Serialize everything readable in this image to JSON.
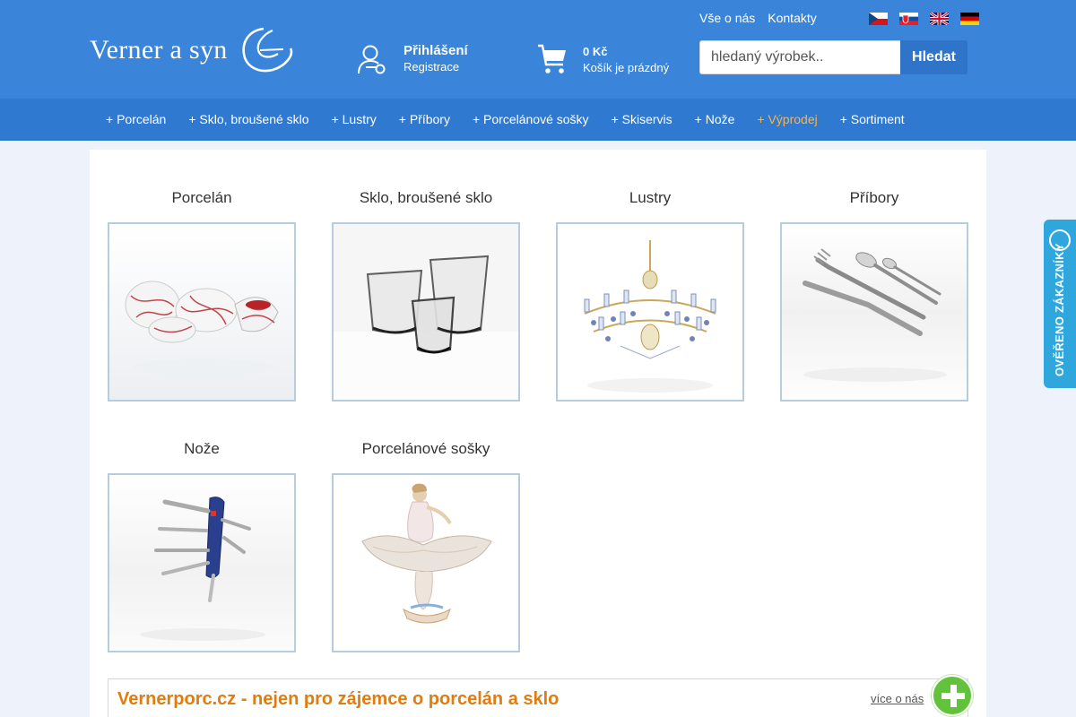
{
  "brand": {
    "logo_text": "Verner a syn"
  },
  "top_links": [
    "Vše o nás",
    "Kontakty"
  ],
  "languages": [
    "cs",
    "sk",
    "en",
    "de"
  ],
  "account": {
    "login_label": "Přihlášení",
    "register_label": "Registrace"
  },
  "cart": {
    "price": "0 Kč",
    "status": "Košík je prázdný"
  },
  "search": {
    "placeholder": "hledaný výrobek..",
    "button_label": "Hledat"
  },
  "nav": {
    "items": [
      "+ Porcelán",
      "+ Sklo, broušené sklo",
      "+ Lustry",
      "+ Příbory",
      "+ Porcelánové sošky",
      "+ Skiservis",
      "+ Nože",
      "+ Výprodej",
      "+ Sortiment"
    ],
    "highlight_color": "#f5b54f"
  },
  "categories": [
    {
      "title": "Porcelán",
      "icon": "porcelain-image"
    },
    {
      "title": "Sklo, broušené sklo",
      "icon": "glass-image"
    },
    {
      "title": "Lustry",
      "icon": "chandelier-image"
    },
    {
      "title": "Příbory",
      "icon": "cutlery-image"
    },
    {
      "title": "Nože",
      "icon": "knife-image"
    },
    {
      "title": "Porcelánové sošky",
      "icon": "figurine-image"
    }
  ],
  "verified_badge": {
    "text": "OVĚŘENO ZÁKAZNÍKY"
  },
  "about": {
    "title": "Vernerporc.cz - nejen pro zájemce o porcelán a sklo",
    "link": "více o nás"
  },
  "colors": {
    "header": "#3a85d9",
    "nav": "#2f79d0",
    "accent_orange": "#e07c10",
    "badge": "#2fa7dc"
  }
}
